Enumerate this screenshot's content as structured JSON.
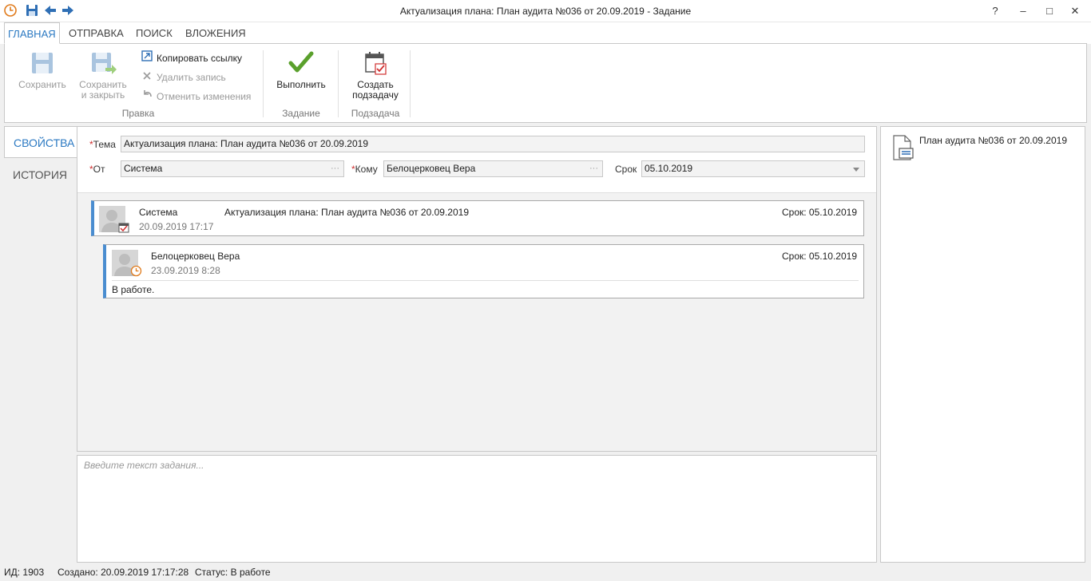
{
  "window": {
    "title": "Актуализация плана: План аудита №036 от 20.09.2019 - Задание",
    "help": "?",
    "minimize": "–",
    "maximize": "□",
    "close": "✕"
  },
  "ribbon_tabs": [
    "ГЛАВНАЯ",
    "ОТПРАВКА",
    "ПОИСК",
    "ВЛОЖЕНИЯ"
  ],
  "ribbon": {
    "save": "Сохранить",
    "save_close_1": "Сохранить",
    "save_close_2": "и закрыть",
    "copy_link": "Копировать ссылку",
    "delete_record": "Удалить запись",
    "undo_changes": "Отменить изменения",
    "group_edit": "Правка",
    "execute": "Выполнить",
    "group_task": "Задание",
    "create_sub_1": "Создать",
    "create_sub_2": "подзадачу",
    "group_subtask": "Подзадача"
  },
  "side_tabs": [
    "СВОЙСТВА",
    "ИСТОРИЯ"
  ],
  "form": {
    "subject_label": "Тема",
    "subject_value": "Актуализация плана: План аудита №036 от 20.09.2019",
    "from_label": "От",
    "from_value": "Система",
    "to_label": "Кому",
    "to_value": "Белоцерковец Вера",
    "due_label": "Срок",
    "due_value": "05.10.2019",
    "required_mark": "*",
    "dots": "···"
  },
  "history": [
    {
      "name": "Система",
      "date": "20.09.2019 17:17",
      "subject": "Актуализация плана: План аудита №036 от 20.09.2019",
      "due": "Срок: 05.10.2019"
    },
    {
      "name": "Белоцерковец Вера",
      "date": "23.09.2019 8:28",
      "due": "Срок: 05.10.2019",
      "body": "В работе."
    }
  ],
  "task_text_placeholder": "Введите текст задания...",
  "attachment": "План аудита №036 от 20.09.2019",
  "status_bar": {
    "id": "ИД: 1903",
    "created": "Создано: 20.09.2019 17:17:28",
    "status": "Статус: В работе"
  },
  "colors": {
    "accent": "#2b79c2",
    "check_green": "#5aa02c",
    "required": "#d03030"
  }
}
